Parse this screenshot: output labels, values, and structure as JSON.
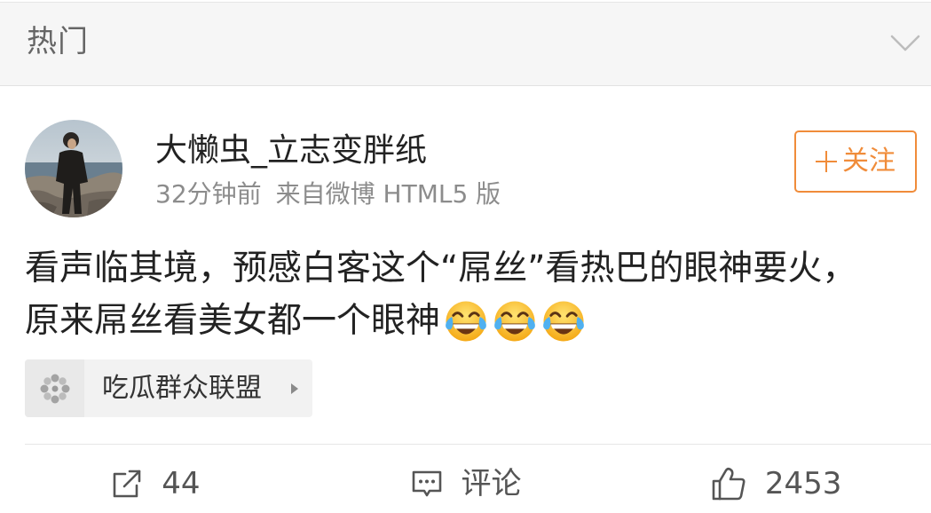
{
  "header": {
    "title": "热门",
    "toggle_icon": "chevron-down-icon"
  },
  "post": {
    "author": {
      "name": "大懒虫_立志变胖纸"
    },
    "meta": {
      "time": "32分钟前",
      "source": "来自微博 HTML5 版"
    },
    "follow_button": {
      "icon": "plus-icon",
      "label": "关注"
    },
    "text_lines": [
      "看声临其境，预感白客这个“屌丝”看热巴的眼神要火，",
      "原来屌丝看美女都一个眼神"
    ],
    "emojis": [
      "face-with-tears-of-joy",
      "face-with-tears-of-joy",
      "face-with-tears-of-joy"
    ],
    "topic": {
      "icon": "topic-flower-icon",
      "label": "吃瓜群众联盟",
      "arrow_icon": "caret-right-icon"
    }
  },
  "actions": {
    "repost": {
      "icon": "repost-icon",
      "count": "44"
    },
    "comment": {
      "icon": "comment-icon",
      "label": "评论"
    },
    "like": {
      "icon": "thumbs-up-icon",
      "count": "2453"
    }
  },
  "colors": {
    "accent": "#f08c3a",
    "text_primary": "#222222",
    "text_secondary": "#8c8c8c",
    "header_bg": "#f6f6f6",
    "chip_bg": "#f2f2f2"
  }
}
